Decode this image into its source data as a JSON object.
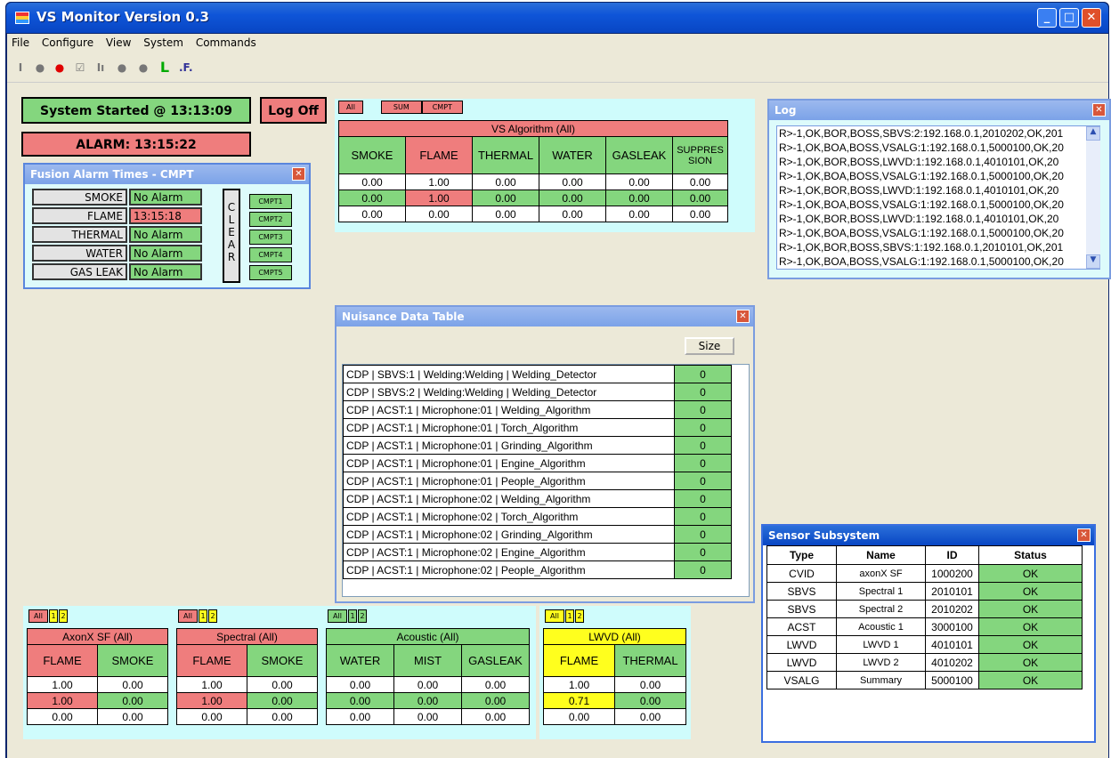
{
  "window": {
    "title": "VS Monitor Version 0.3",
    "min": "_",
    "max": "□",
    "close": "✕"
  },
  "menu": [
    "File",
    "Configure",
    "View",
    "System",
    "Commands"
  ],
  "status": {
    "started": "System Started @ 13:13:09",
    "logoff": "Log Off",
    "alarm": "ALARM: 13:15:22"
  },
  "fusion": {
    "title": "Fusion Alarm Times - CMPT",
    "rows": [
      {
        "label": "SMOKE",
        "value": "No Alarm",
        "state": "ok"
      },
      {
        "label": "FLAME",
        "value": "13:15:18",
        "state": "alarm"
      },
      {
        "label": "THERMAL",
        "value": "No Alarm",
        "state": "ok"
      },
      {
        "label": "WATER",
        "value": "No Alarm",
        "state": "ok"
      },
      {
        "label": "GAS LEAK",
        "value": "No Alarm",
        "state": "ok"
      }
    ],
    "clear": "C L E A R",
    "cmpt": [
      "CMPT1",
      "CMPT2",
      "CMPT3",
      "CMPT4",
      "CMPT5"
    ]
  },
  "vsalg": {
    "tabs": [
      "All",
      "SUM",
      "CMPT"
    ],
    "title": "VS Algorithm (All)",
    "cols": [
      "SMOKE",
      "FLAME",
      "THERMAL",
      "WATER",
      "GASLEAK",
      "SUPPRES SION"
    ],
    "rows": [
      [
        "0.00",
        "1.00",
        "0.00",
        "0.00",
        "0.00",
        "0.00"
      ],
      [
        "0.00",
        "1.00",
        "0.00",
        "0.00",
        "0.00",
        "0.00"
      ],
      [
        "0.00",
        "0.00",
        "0.00",
        "0.00",
        "0.00",
        "0.00"
      ]
    ]
  },
  "log": {
    "title": "Log",
    "lines": [
      "R>-1,OK,BOR,BOSS,SBVS:2:192.168.0.1,2010202,OK,201",
      "R>-1,OK,BOA,BOSS,VSALG:1:192.168.0.1,5000100,OK,20",
      "R>-1,OK,BOR,BOSS,LWVD:1:192.168.0.1,4010101,OK,20",
      "R>-1,OK,BOA,BOSS,VSALG:1:192.168.0.1,5000100,OK,20",
      "R>-1,OK,BOR,BOSS,LWVD:1:192.168.0.1,4010101,OK,20",
      "R>-1,OK,BOA,BOSS,VSALG:1:192.168.0.1,5000100,OK,20",
      "R>-1,OK,BOR,BOSS,LWVD:1:192.168.0.1,4010101,OK,20",
      "R>-1,OK,BOA,BOSS,VSALG:1:192.168.0.1,5000100,OK,20",
      "R>-1,OK,BOR,BOSS,SBVS:1:192.168.0.1,2010101,OK,201",
      "R>-1,OK,BOA,BOSS,VSALG:1:192.168.0.1,5000100,OK,20"
    ]
  },
  "nuisance": {
    "title": "Nuisance Data Table",
    "size": "Size",
    "rows": [
      {
        "label": "CDP | SBVS:1 | Welding:Welding | Welding_Detector",
        "value": "0"
      },
      {
        "label": "CDP | SBVS:2 | Welding:Welding | Welding_Detector",
        "value": "0"
      },
      {
        "label": "CDP | ACST:1 | Microphone:01 | Welding_Algorithm",
        "value": "0"
      },
      {
        "label": "CDP | ACST:1 | Microphone:01 | Torch_Algorithm",
        "value": "0"
      },
      {
        "label": "CDP | ACST:1 | Microphone:01 | Grinding_Algorithm",
        "value": "0"
      },
      {
        "label": "CDP | ACST:1 | Microphone:01 | Engine_Algorithm",
        "value": "0"
      },
      {
        "label": "CDP | ACST:1 | Microphone:01 | People_Algorithm",
        "value": "0"
      },
      {
        "label": "CDP | ACST:1 | Microphone:02 | Welding_Algorithm",
        "value": "0"
      },
      {
        "label": "CDP | ACST:1 | Microphone:02 | Torch_Algorithm",
        "value": "0"
      },
      {
        "label": "CDP | ACST:1 | Microphone:02 | Grinding_Algorithm",
        "value": "0"
      },
      {
        "label": "CDP | ACST:1 | Microphone:02 | Engine_Algorithm",
        "value": "0"
      },
      {
        "label": "CDP | ACST:1 | Microphone:02 | People_Algorithm",
        "value": "0"
      }
    ]
  },
  "sensor": {
    "title": "Sensor Subsystem",
    "cols": [
      "Type",
      "Name",
      "ID",
      "Status"
    ],
    "rows": [
      [
        "CVID",
        "axonX SF",
        "1000200",
        "OK"
      ],
      [
        "SBVS",
        "Spectral 1",
        "2010101",
        "OK"
      ],
      [
        "SBVS",
        "Spectral 2",
        "2010202",
        "OK"
      ],
      [
        "ACST",
        "Acoustic 1",
        "3000100",
        "OK"
      ],
      [
        "LWVD",
        "LWVD 1",
        "4010101",
        "OK"
      ],
      [
        "LWVD",
        "LWVD 2",
        "4010202",
        "OK"
      ],
      [
        "VSALG",
        "Summary",
        "5000100",
        "OK"
      ]
    ]
  },
  "bottom": [
    {
      "tabs": [
        "All",
        "1",
        "2"
      ],
      "title": "AxonX SF (All)",
      "cols": [
        "FLAME",
        "SMOKE"
      ],
      "rows": [
        [
          "1.00",
          "0.00"
        ],
        [
          "1.00",
          "0.00"
        ],
        [
          "0.00",
          "0.00"
        ]
      ]
    },
    {
      "tabs": [
        "All",
        "1",
        "2"
      ],
      "title": "Spectral (All)",
      "cols": [
        "FLAME",
        "SMOKE"
      ],
      "rows": [
        [
          "1.00",
          "0.00"
        ],
        [
          "1.00",
          "0.00"
        ],
        [
          "0.00",
          "0.00"
        ]
      ]
    },
    {
      "tabs": [
        "All",
        "1",
        "2"
      ],
      "title": "Acoustic (All)",
      "cols": [
        "WATER",
        "MIST",
        "GASLEAK"
      ],
      "rows": [
        [
          "0.00",
          "0.00",
          "0.00"
        ],
        [
          "0.00",
          "0.00",
          "0.00"
        ],
        [
          "0.00",
          "0.00",
          "0.00"
        ]
      ]
    },
    {
      "tabs": [
        "All",
        "1",
        "2"
      ],
      "title": "LWVD (All)",
      "cols": [
        "FLAME",
        "THERMAL"
      ],
      "rows": [
        [
          "1.00",
          "0.00"
        ],
        [
          "0.71",
          "0.00"
        ],
        [
          "0.00",
          "0.00"
        ]
      ]
    }
  ]
}
